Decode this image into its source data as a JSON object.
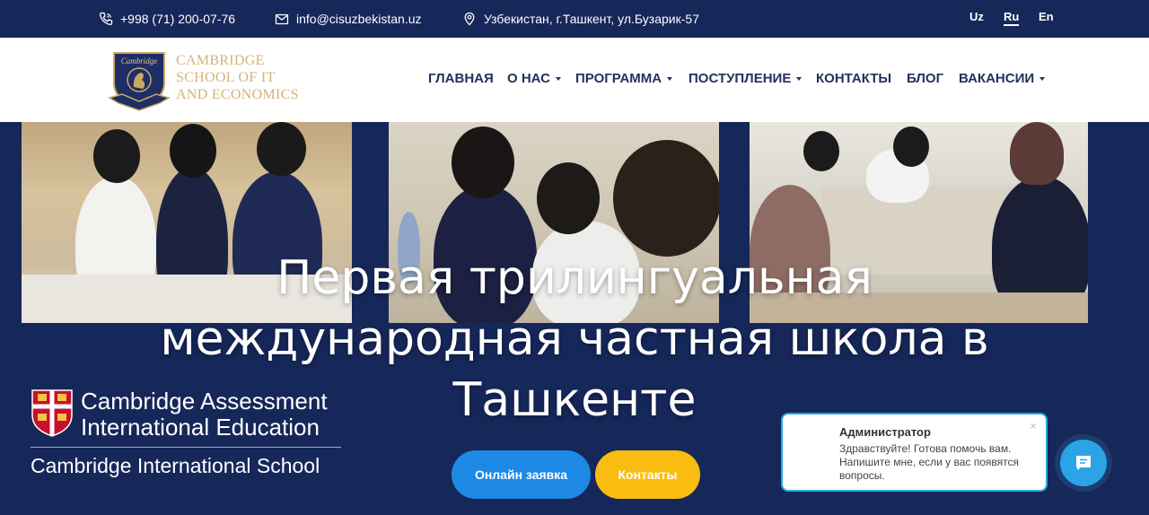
{
  "topbar": {
    "phone": "+998 (71) 200-07-76",
    "email": "info@cisuzbekistan.uz",
    "address": "Узбекистан, г.Ташкент, ул.Бузарик-57",
    "languages": [
      "Uz",
      "Ru",
      "En"
    ],
    "active_language": "Ru"
  },
  "logo": {
    "crest_text": "Cambridge",
    "line1": "CAMBRIDGE",
    "line2": "SCHOOL OF IT",
    "line3": "AND ECONOMICS"
  },
  "nav": {
    "items": [
      {
        "label": "ГЛАВНАЯ",
        "dropdown": false
      },
      {
        "label": "О НАС",
        "dropdown": true
      },
      {
        "label": "ПРОГРАММА",
        "dropdown": true
      },
      {
        "label": "ПОСТУПЛЕНИЕ",
        "dropdown": true
      },
      {
        "label": "КОНТАКТЫ",
        "dropdown": false
      },
      {
        "label": "БЛОГ",
        "dropdown": false
      },
      {
        "label": "ВАКАНСИИ",
        "dropdown": true
      }
    ]
  },
  "hero": {
    "title_line1": "Первая трилингуальная",
    "title_line2": "международная частная школа в",
    "title_line3": "Ташкенте",
    "primary_button": "Онлайн заявка",
    "secondary_button": "Контакты"
  },
  "cambridge_badge": {
    "line1": "Cambridge Assessment",
    "line2": "International Education",
    "line3": "Cambridge International School"
  },
  "chat": {
    "name": "Администратор",
    "message": "Здравствуйте! Готова помочь вам. Напишите мне, если у вас появятся вопросы.",
    "close": "×"
  },
  "colors": {
    "navy": "#16275a",
    "gold": "#d3b377",
    "blue_button": "#1e88e5",
    "yellow_button": "#fbbc12",
    "chat_accent": "#25a8e0"
  }
}
